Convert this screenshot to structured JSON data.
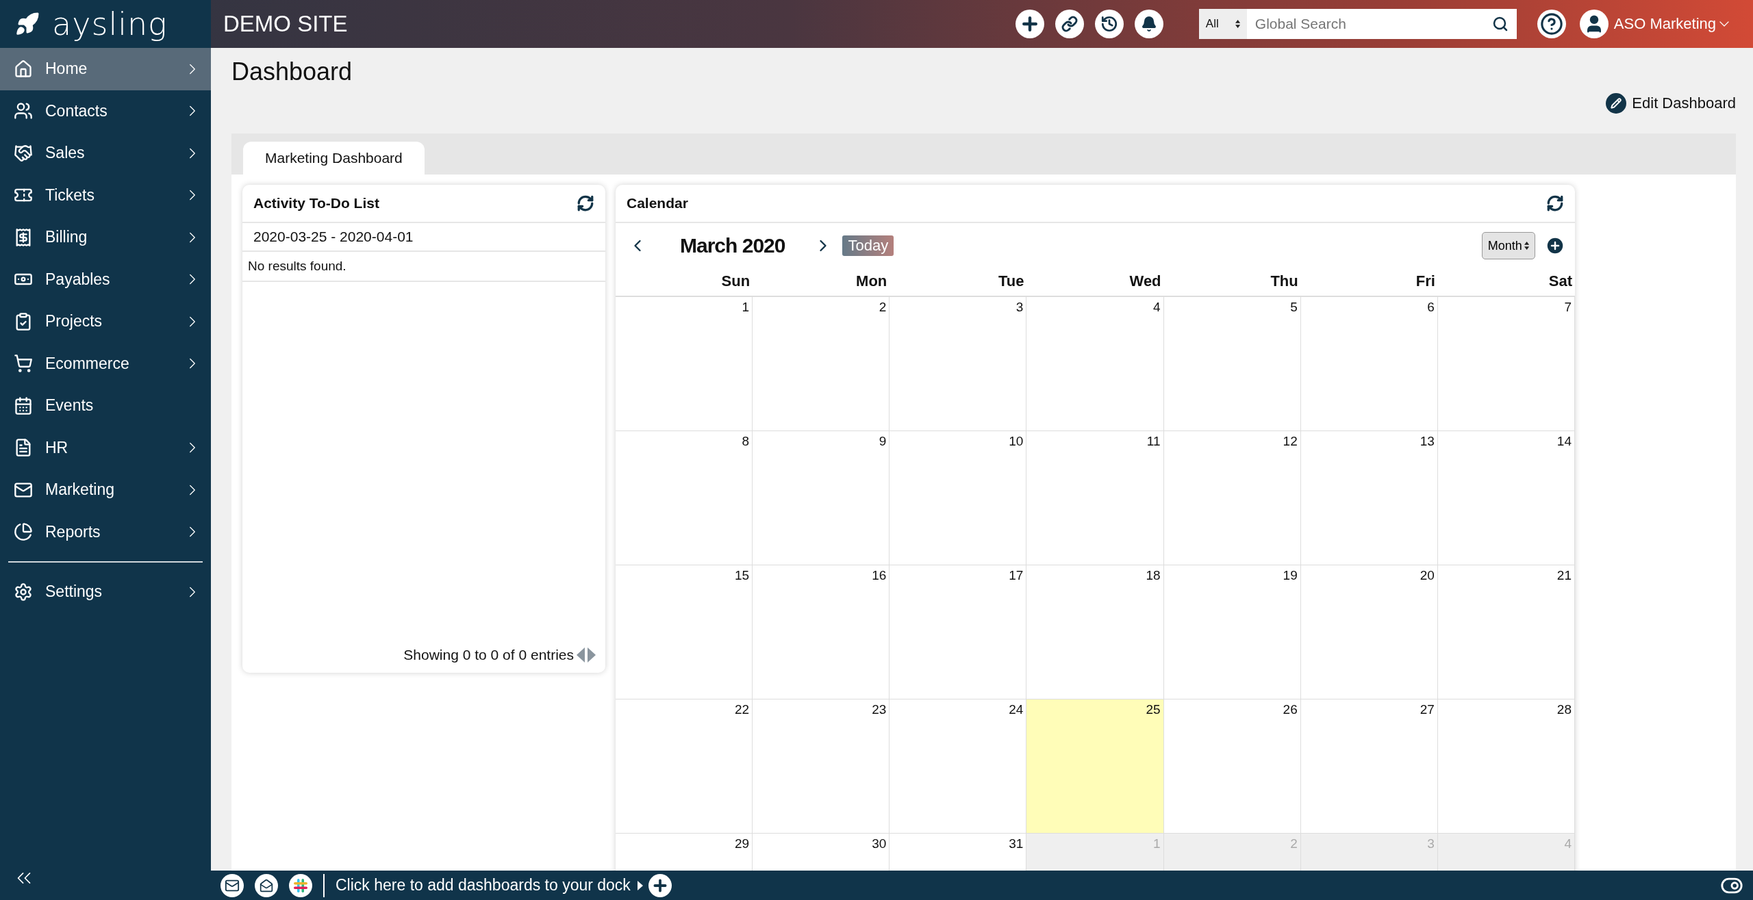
{
  "header": {
    "logo": "aysling",
    "site_title": "DEMO SITE",
    "search": {
      "scope": "All",
      "placeholder": "Global Search"
    },
    "user": "ASO Marketing"
  },
  "sidebar": {
    "items": [
      {
        "label": "Home",
        "selected": true,
        "has_submenu": true
      },
      {
        "label": "Contacts",
        "selected": false,
        "has_submenu": true
      },
      {
        "label": "Sales",
        "selected": false,
        "has_submenu": true
      },
      {
        "label": "Tickets",
        "selected": false,
        "has_submenu": true
      },
      {
        "label": "Billing",
        "selected": false,
        "has_submenu": true
      },
      {
        "label": "Payables",
        "selected": false,
        "has_submenu": true
      },
      {
        "label": "Projects",
        "selected": false,
        "has_submenu": true
      },
      {
        "label": "Ecommerce",
        "selected": false,
        "has_submenu": true
      },
      {
        "label": "Events",
        "selected": false,
        "has_submenu": false
      },
      {
        "label": "HR",
        "selected": false,
        "has_submenu": true
      },
      {
        "label": "Marketing",
        "selected": false,
        "has_submenu": true
      },
      {
        "label": "Reports",
        "selected": false,
        "has_submenu": true
      }
    ],
    "settings": {
      "label": "Settings",
      "selected": false,
      "has_submenu": true
    }
  },
  "page": {
    "title": "Dashboard",
    "edit_button": "Edit Dashboard"
  },
  "tabs": [
    {
      "label": "Marketing Dashboard",
      "selected": true
    }
  ],
  "activity": {
    "title": "Activity To-Do List",
    "date_range": "2020-03-25 - 2020-04-01",
    "empty_text": "No results found.",
    "footer": "Showing 0 to 0 of 0 entries"
  },
  "calendar": {
    "title": "Calendar",
    "month": "March 2020",
    "today_button": "Today",
    "view": "Month",
    "weekdays": [
      "Sun",
      "Mon",
      "Tue",
      "Wed",
      "Thu",
      "Fri",
      "Sat"
    ],
    "weeks": [
      [
        {
          "day": "1",
          "other_month": false,
          "today": false
        },
        {
          "day": "2",
          "other_month": false,
          "today": false
        },
        {
          "day": "3",
          "other_month": false,
          "today": false
        },
        {
          "day": "4",
          "other_month": false,
          "today": false
        },
        {
          "day": "5",
          "other_month": false,
          "today": false
        },
        {
          "day": "6",
          "other_month": false,
          "today": false
        },
        {
          "day": "7",
          "other_month": false,
          "today": false
        }
      ],
      [
        {
          "day": "8",
          "other_month": false,
          "today": false
        },
        {
          "day": "9",
          "other_month": false,
          "today": false
        },
        {
          "day": "10",
          "other_month": false,
          "today": false
        },
        {
          "day": "11",
          "other_month": false,
          "today": false
        },
        {
          "day": "12",
          "other_month": false,
          "today": false
        },
        {
          "day": "13",
          "other_month": false,
          "today": false
        },
        {
          "day": "14",
          "other_month": false,
          "today": false
        }
      ],
      [
        {
          "day": "15",
          "other_month": false,
          "today": false
        },
        {
          "day": "16",
          "other_month": false,
          "today": false
        },
        {
          "day": "17",
          "other_month": false,
          "today": false
        },
        {
          "day": "18",
          "other_month": false,
          "today": false
        },
        {
          "day": "19",
          "other_month": false,
          "today": false
        },
        {
          "day": "20",
          "other_month": false,
          "today": false
        },
        {
          "day": "21",
          "other_month": false,
          "today": false
        }
      ],
      [
        {
          "day": "22",
          "other_month": false,
          "today": false
        },
        {
          "day": "23",
          "other_month": false,
          "today": false
        },
        {
          "day": "24",
          "other_month": false,
          "today": false
        },
        {
          "day": "25",
          "other_month": false,
          "today": true
        },
        {
          "day": "26",
          "other_month": false,
          "today": false
        },
        {
          "day": "27",
          "other_month": false,
          "today": false
        },
        {
          "day": "28",
          "other_month": false,
          "today": false
        }
      ],
      [
        {
          "day": "29",
          "other_month": false,
          "today": false
        },
        {
          "day": "30",
          "other_month": false,
          "today": false
        },
        {
          "day": "31",
          "other_month": false,
          "today": false
        },
        {
          "day": "1",
          "other_month": true,
          "today": false
        },
        {
          "day": "2",
          "other_month": true,
          "today": false
        },
        {
          "day": "3",
          "other_month": true,
          "today": false
        },
        {
          "day": "4",
          "other_month": true,
          "today": false
        }
      ]
    ]
  },
  "dock": {
    "text": "Click here to add dashboards to your dock"
  }
}
